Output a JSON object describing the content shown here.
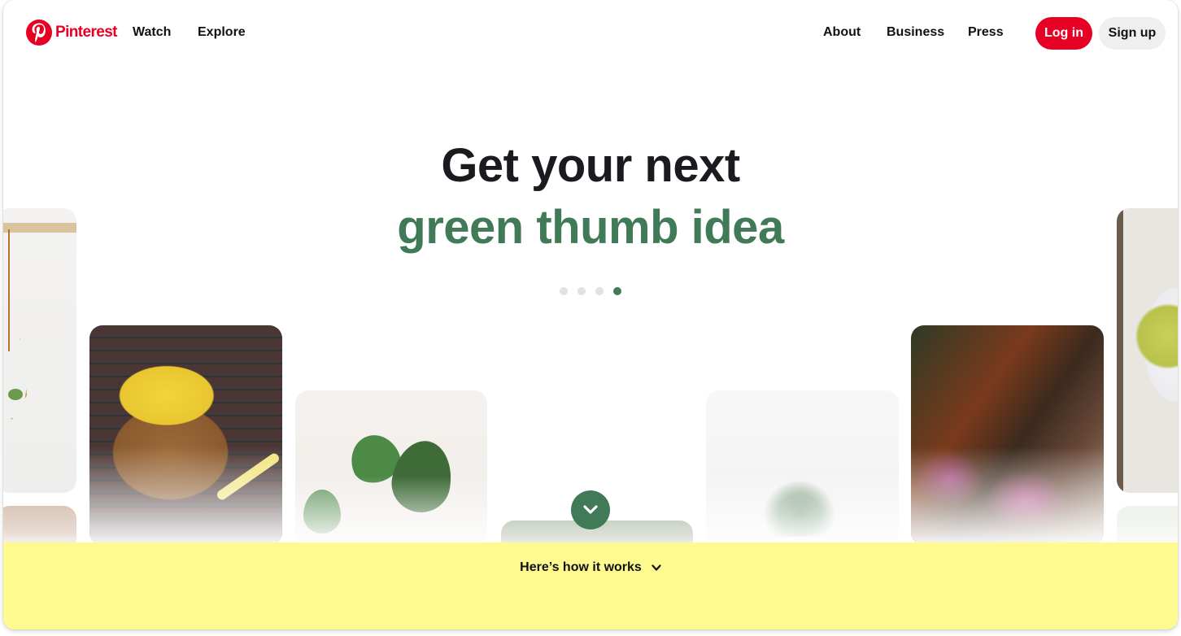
{
  "header": {
    "brand": "Pinterest",
    "nav_left": [
      "Watch",
      "Explore"
    ],
    "nav_right": [
      "About",
      "Business",
      "Press"
    ],
    "login_label": "Log in",
    "signup_label": "Sign up"
  },
  "hero": {
    "line1": "Get your next",
    "line2": "green thumb idea",
    "carousel": {
      "total": 4,
      "active_index": 3
    }
  },
  "cards": [
    "hanging-planter",
    "bicycle-tulips-basket",
    "monstera-plant",
    "green-wall",
    "palm-indoor",
    "rust-sculpture-garden",
    "pears-bowl",
    "hair-portrait",
    "sprouts"
  ],
  "footer": {
    "how_it_works_label": "Here’s how it works"
  },
  "colors": {
    "brand_red": "#e60023",
    "accent_green": "#407a57",
    "band_yellow": "#fffa8f",
    "signup_gray": "#efefef"
  }
}
